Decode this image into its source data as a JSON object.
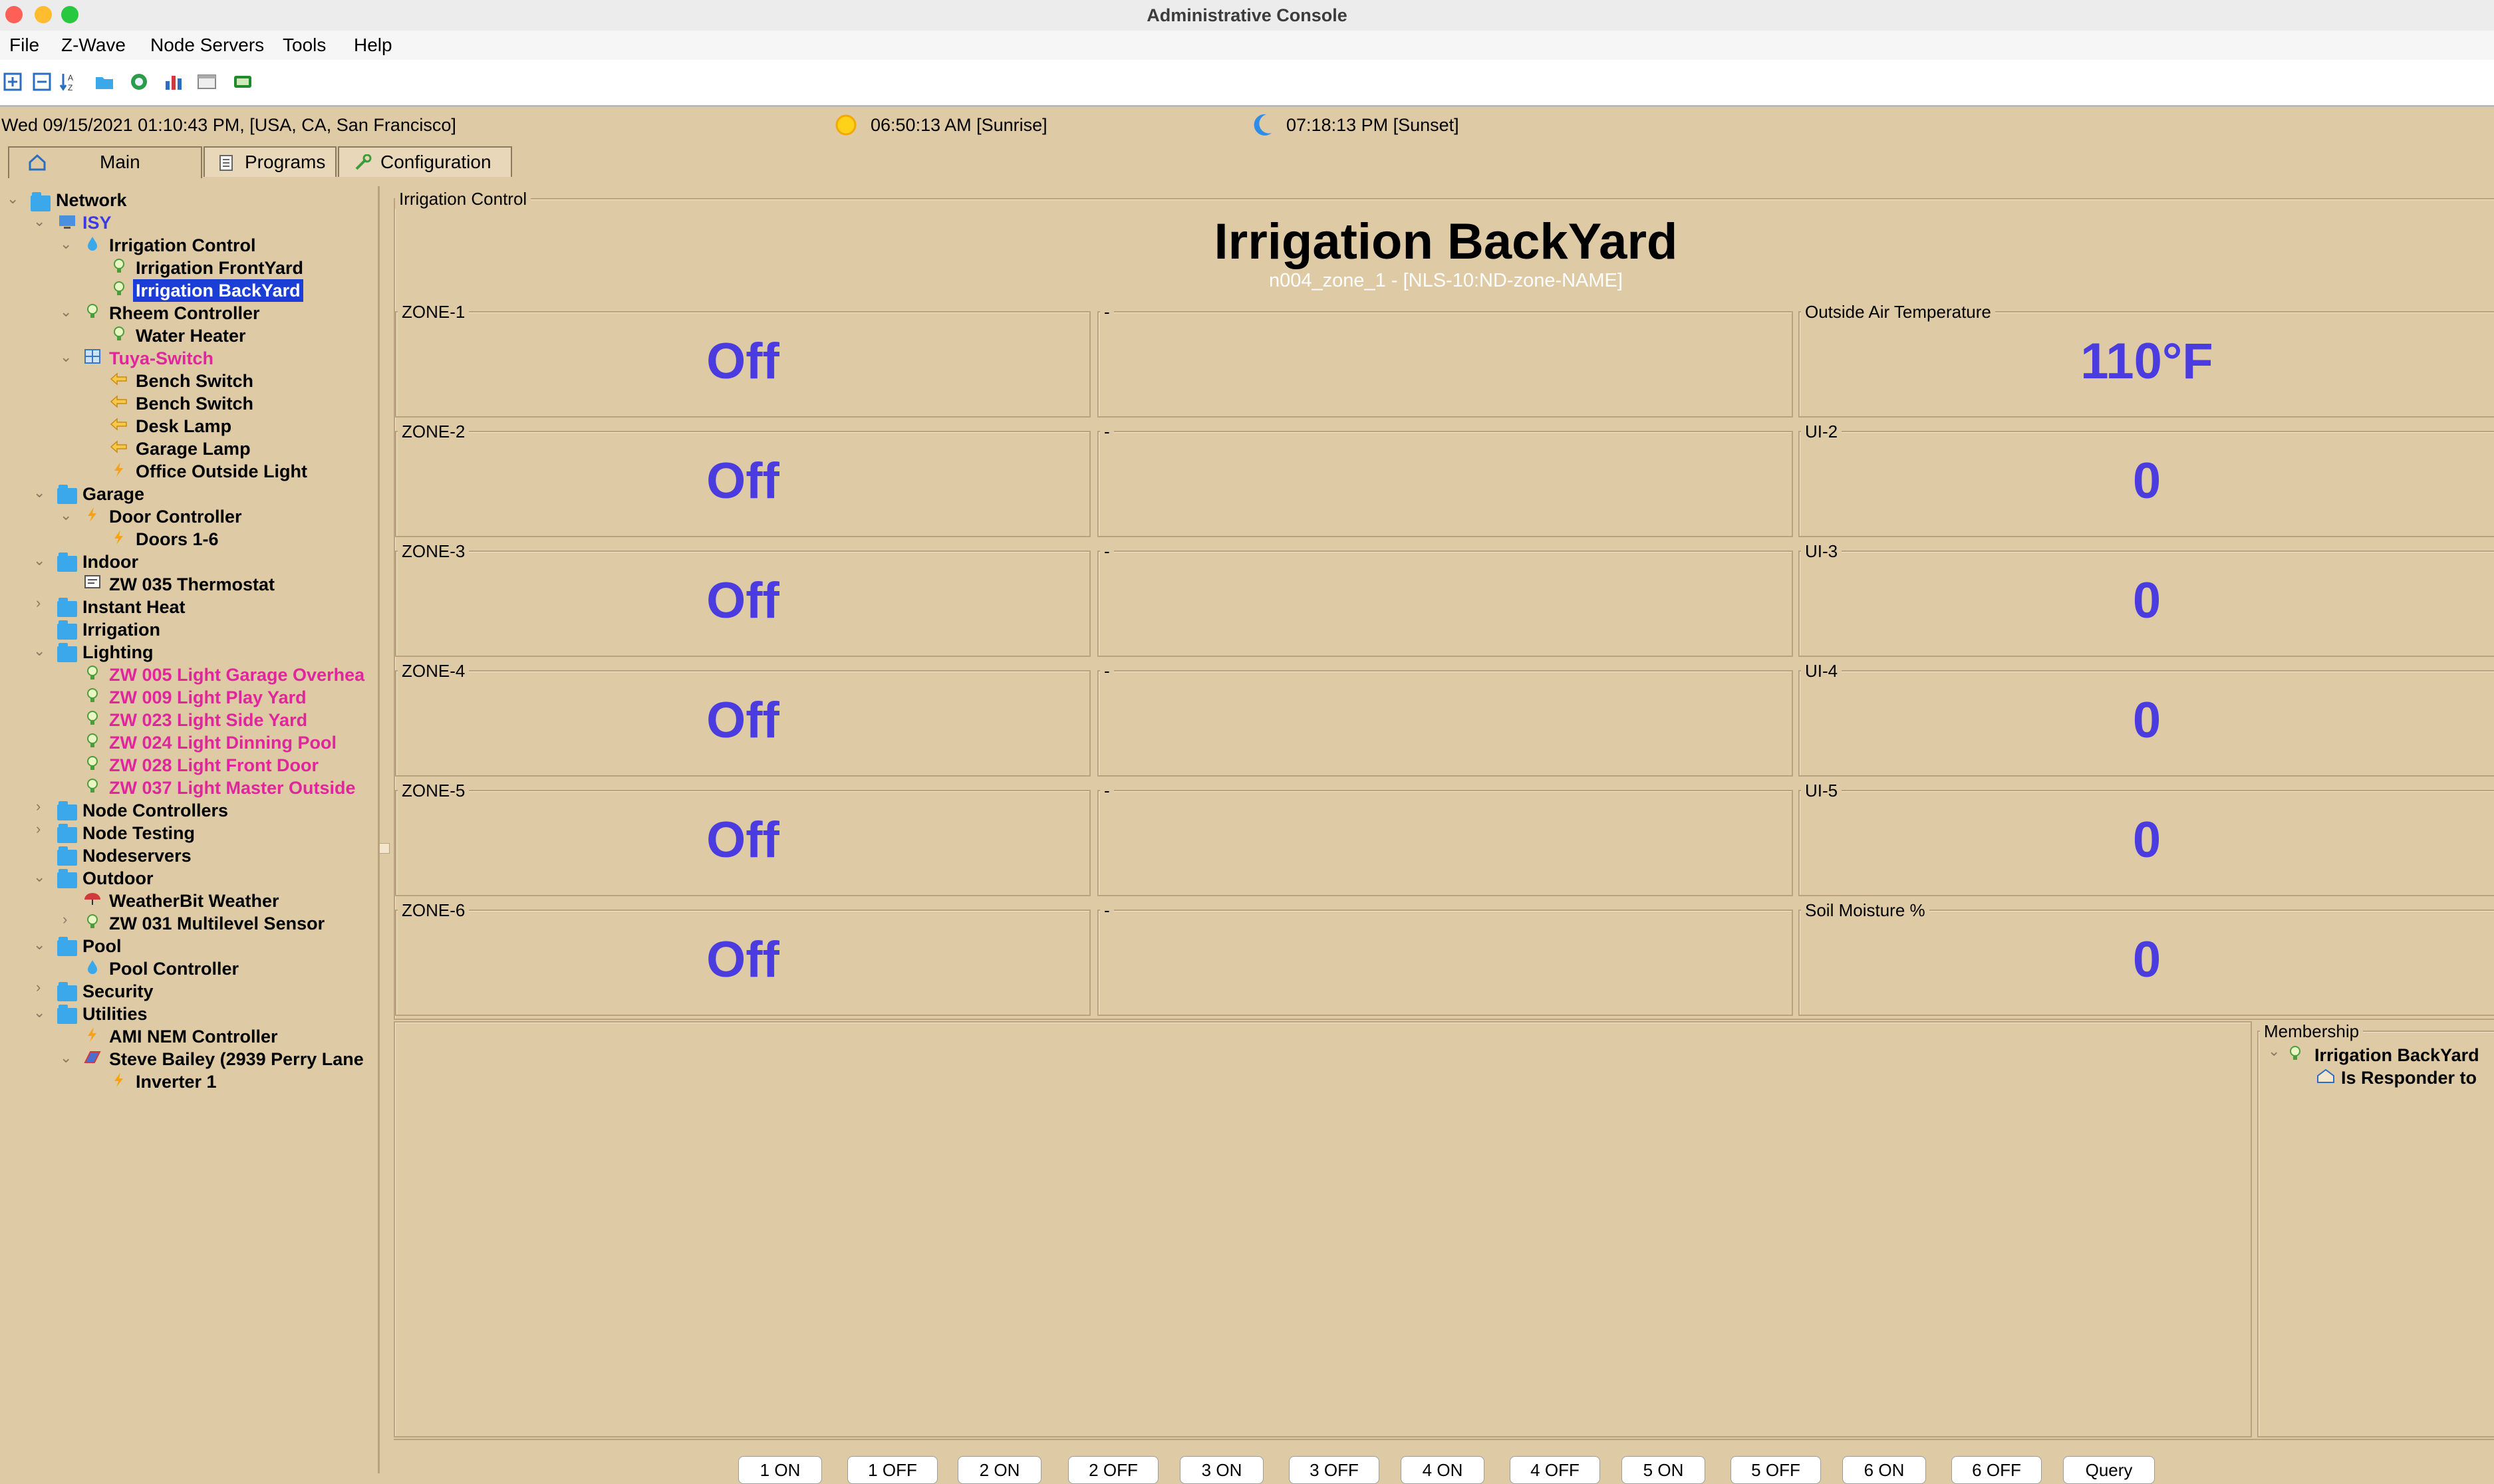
{
  "window": {
    "title": "Administrative Console"
  },
  "menu": [
    "File",
    "Z-Wave",
    "Node Servers",
    "Tools",
    "Help"
  ],
  "toolbar_icons": [
    "expand-tree-icon",
    "collapse-tree-icon",
    "sort-icon",
    "folder-icon",
    "network-icon",
    "chart-icon",
    "window-icon",
    "battery-icon"
  ],
  "status": {
    "datetime": "Wed 09/15/2021 01:10:43 PM,  [USA, CA, San Francisco]",
    "sunrise": "06:50:13 AM [Sunrise]",
    "sunset": "07:18:13 PM [Sunset]"
  },
  "tabs": [
    "Main",
    "Programs",
    "Configuration"
  ],
  "tree": {
    "network": "Network",
    "isy": "ISY",
    "irrigation_control": "Irrigation Control",
    "irrigation_frontyard": "Irrigation FrontYard",
    "irrigation_backyard": "Irrigation BackYard",
    "rheem_controller": "Rheem Controller",
    "water_heater": "Water Heater",
    "tuya_switch": "Tuya-Switch",
    "bench_switch_1": "Bench Switch",
    "bench_switch_2": "Bench Switch",
    "desk_lamp": "Desk Lamp",
    "garage_lamp": "Garage Lamp",
    "office_outside_light": "Office Outside Light",
    "garage": "Garage",
    "door_controller": "Door Controller",
    "doors": "Doors 1-6",
    "indoor": "Indoor",
    "thermostat": "ZW 035 Thermostat",
    "instant_heat": "Instant Heat",
    "irrigation": "Irrigation",
    "lighting": "Lighting",
    "light_005": "ZW 005 Light Garage Overhea",
    "light_009": "ZW 009 Light Play Yard",
    "light_023": "ZW 023 Light Side Yard",
    "light_024": "ZW 024 Light Dinning Pool",
    "light_028": "ZW 028 Light Front Door",
    "light_037": "ZW 037 Light Master Outside",
    "node_controllers": "Node Controllers",
    "node_testing": "Node Testing",
    "nodeservers": "Nodeservers",
    "outdoor": "Outdoor",
    "weatherbit": "WeatherBit Weather",
    "multilevel_sensor": "ZW 031 Multilevel Sensor",
    "pool": "Pool",
    "pool_controller": "Pool Controller",
    "security": "Security",
    "utilities": "Utilities",
    "ami_nem": "AMI NEM Controller",
    "steve_bailey": "Steve Bailey (2939 Perry Lane",
    "inverter": "Inverter 1"
  },
  "main": {
    "group_label": "Irrigation Control",
    "title": "Irrigation BackYard",
    "subtitle": "n004_zone_1 - [NLS-10:ND-zone-NAME]",
    "zones": [
      {
        "label": "ZONE-1",
        "value": "Off"
      },
      {
        "label": "ZONE-2",
        "value": "Off"
      },
      {
        "label": "ZONE-3",
        "value": "Off"
      },
      {
        "label": "ZONE-4",
        "value": "Off"
      },
      {
        "label": "ZONE-5",
        "value": "Off"
      },
      {
        "label": "ZONE-6",
        "value": "Off"
      }
    ],
    "middle_label": "-",
    "right": [
      {
        "label": "Outside Air Temperature",
        "value": "110°F"
      },
      {
        "label": "UI-2",
        "value": "0"
      },
      {
        "label": "UI-3",
        "value": "0"
      },
      {
        "label": "UI-4",
        "value": "0"
      },
      {
        "label": "UI-5",
        "value": "0"
      },
      {
        "label": "Soil Moisture %",
        "value": "0"
      }
    ],
    "membership": {
      "label": "Membership",
      "item": "Irrigation BackYard",
      "child": "Is Responder to"
    }
  },
  "buttons": [
    "1 ON",
    "1 OFF",
    "2 ON",
    "2 OFF",
    "3 ON",
    "3 OFF",
    "4 ON",
    "4 OFF",
    "5 ON",
    "5 OFF",
    "6 ON",
    "6 OFF",
    "Query"
  ]
}
